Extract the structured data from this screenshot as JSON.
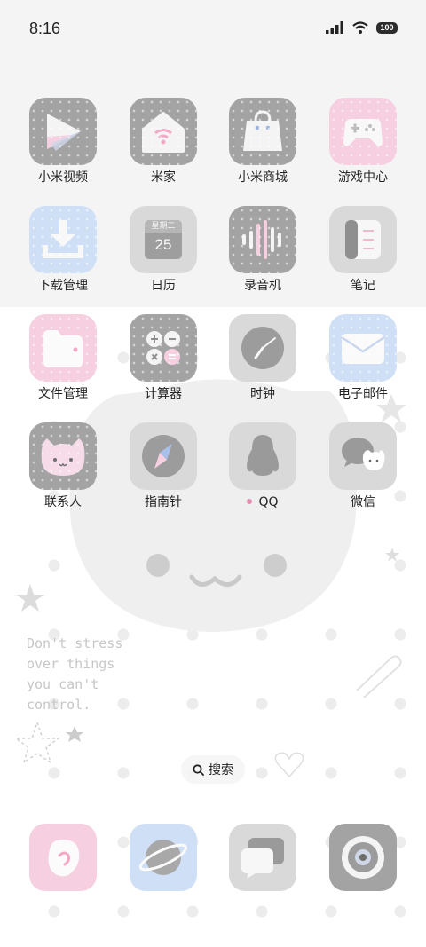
{
  "status_bar": {
    "time": "8:16",
    "battery": "100"
  },
  "home_apps": [
    {
      "label": "小米视频",
      "icon": "video-play-icon"
    },
    {
      "label": "米家",
      "icon": "smart-home-icon"
    },
    {
      "label": "小米商城",
      "icon": "shopping-bag-icon"
    },
    {
      "label": "游戏中心",
      "icon": "gamepad-icon"
    },
    {
      "label": "下载管理",
      "icon": "download-icon"
    },
    {
      "label": "日历",
      "icon": "calendar-icon",
      "weekday": "星期二",
      "day": "25"
    },
    {
      "label": "录音机",
      "icon": "sound-wave-icon"
    },
    {
      "label": "笔记",
      "icon": "notes-icon"
    },
    {
      "label": "文件管理",
      "icon": "folder-icon"
    },
    {
      "label": "计算器",
      "icon": "calculator-icon"
    },
    {
      "label": "时钟",
      "icon": "clock-icon"
    },
    {
      "label": "电子邮件",
      "icon": "envelope-icon"
    },
    {
      "label": "联系人",
      "icon": "cat-contact-icon"
    },
    {
      "label": "指南针",
      "icon": "compass-icon"
    },
    {
      "label": "QQ",
      "icon": "penguin-icon",
      "has_new_dot": true
    },
    {
      "label": "微信",
      "icon": "wechat-icon"
    }
  ],
  "search": {
    "label": "搜索"
  },
  "dock": [
    {
      "name": "phone",
      "icon": "phone-icon"
    },
    {
      "name": "browser",
      "icon": "planet-icon"
    },
    {
      "name": "messages",
      "icon": "message-icon"
    },
    {
      "name": "camera",
      "icon": "camera-lens-icon"
    }
  ],
  "wallpaper": {
    "quote_lines": [
      "Don't stress",
      "over things",
      "you can't",
      "control."
    ]
  },
  "colors": {
    "gray_tile": "#a3a3a3",
    "light_gray_tile": "#d9d9d9",
    "pink_tile": "#f6cfe0",
    "blue_tile": "#cfe0f6"
  }
}
